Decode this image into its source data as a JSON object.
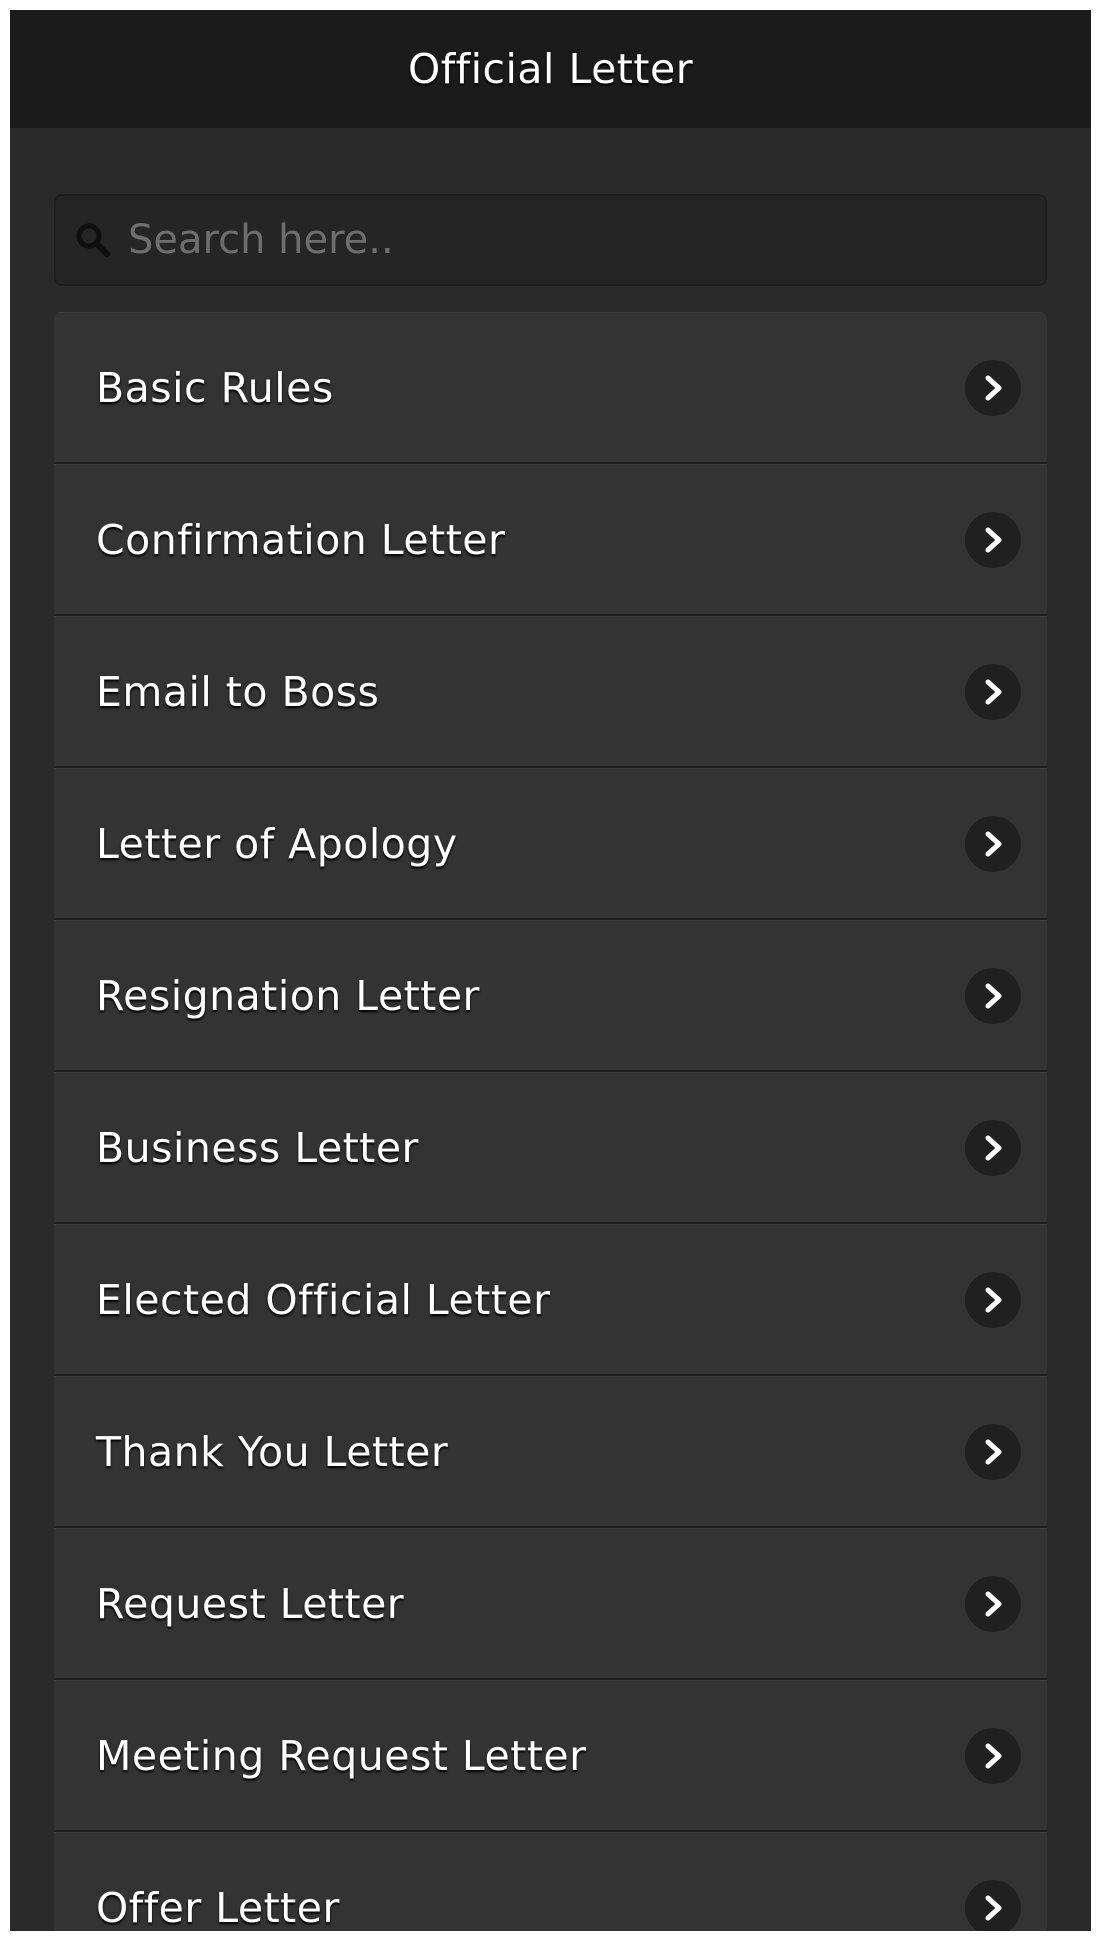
{
  "header": {
    "title": "Official Letter"
  },
  "search": {
    "placeholder": "Search here..",
    "value": "",
    "icon": "search-icon"
  },
  "list": {
    "items": [
      {
        "label": "Basic Rules",
        "icon": "chevron-right-icon"
      },
      {
        "label": "Confirmation Letter",
        "icon": "chevron-right-icon"
      },
      {
        "label": "Email to Boss",
        "icon": "chevron-right-icon"
      },
      {
        "label": "Letter of Apology",
        "icon": "chevron-right-icon"
      },
      {
        "label": "Resignation Letter",
        "icon": "chevron-right-icon"
      },
      {
        "label": "Business Letter",
        "icon": "chevron-right-icon"
      },
      {
        "label": "Elected Official Letter",
        "icon": "chevron-right-icon"
      },
      {
        "label": "Thank You Letter",
        "icon": "chevron-right-icon"
      },
      {
        "label": "Request Letter",
        "icon": "chevron-right-icon"
      },
      {
        "label": "Meeting Request Letter",
        "icon": "chevron-right-icon"
      },
      {
        "label": "Offer Letter",
        "icon": "chevron-right-icon"
      }
    ]
  },
  "colors": {
    "header_bg": "#1b1b1b",
    "page_bg": "#2a2a2a",
    "item_bg": "#333333",
    "text": "#ffffff",
    "placeholder": "#6e6e6e"
  }
}
